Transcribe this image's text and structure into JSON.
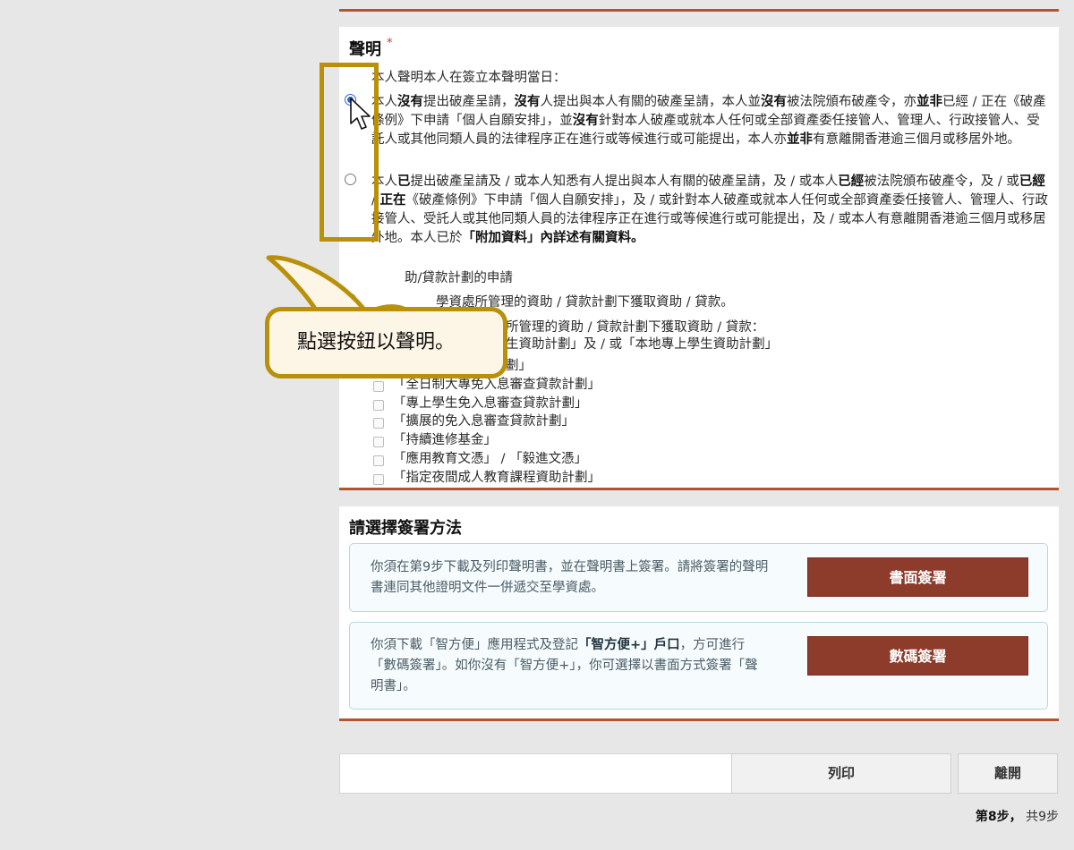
{
  "declaration": {
    "title": "聲明",
    "required_mark": "*",
    "intro": "本人聲明本人在簽立本聲明當日：",
    "option1": {
      "selected": true,
      "text_html": "本人<b>沒有</b>提出破產呈請，<b>沒有</b>人提出與本人有關的破產呈請，本人並<b>沒有</b>被法院頒布破產令，亦<b>並非</b>已經 / 正在《破產條例》下申請「個人自願安排」，並<b>沒有</b>針對本人破產或就本人任何或全部資產委任接管人、管理人、行政接管人、受託人或其他同類人員的法律程序正在進行或等候進行或可能提出，本人亦<b>並非</b>有意離開香港逾三個月或移居外地。"
    },
    "option2": {
      "selected": false,
      "text_html": "本人<b>已</b>提出破產呈請及 / 或本人知悉有人提出與本人有關的破產呈請，及 / 或本人<b>已經</b>被法院頒布破產令，及 / 或<b>已經</b> / <b>正在</b>《破產條例》下申請「個人自願安排」，及 / 或針對本人破產或就本人任何或全部資產委任接管人、管理人、行政接管人、受託人或其他同類人員的法律程序正在進行或等候進行或可能提出，及 / 或本人有意離開香港逾三個月或移居外地。本人已於<b>「附加資料」內詳述有關資料。</b>"
    }
  },
  "aid": {
    "heading": "助/貸款計劃的申請",
    "option1": {
      "selected": true,
      "text": "學資處所管理的資助 / 貸款計劃下獲取資助 / 貸款。"
    },
    "option2_line1": "所管理的資助 / 貸款計劃下獲取資助 / 貸款：",
    "option2_line2": "生資助計劃」及 / 或「本地專上學生資助計劃」",
    "checkboxes": [
      "劃」",
      "「全日制大專免入息審查貸款計劃」",
      "「專上學生免入息審查貸款計劃」",
      "「擴展的免入息審查貸款計劃」",
      "「持續進修基金」",
      "「應用教育文憑」 / 「毅進文憑」",
      "「指定夜間成人教育課程資助計劃」"
    ]
  },
  "sign": {
    "title": "請選擇簽署方法",
    "paper": {
      "text_html": "你須在第9步下載及列印聲明書，並在聲明書上簽署。請將簽署的聲明書連同其他證明文件一併遞交至學資處。",
      "button": "書面簽署"
    },
    "digital": {
      "text_html": "你須下載「智方便」應用程式及登記<b>「智方便+」戶口</b>，方可進行「數碼簽署」。如你沒有「智方便+」，你可選擇以書面方式簽署「聲明書」。",
      "button": "數碼簽署"
    }
  },
  "footer": {
    "print_button": "列印",
    "exit_button": "離開",
    "step_current": "第8步，",
    "step_total": "共9步"
  },
  "callout": {
    "text": "點選按鈕以聲明。"
  },
  "colors": {
    "accent_rule": "#b5532c",
    "sign_button": "#8d3b2a",
    "highlight": "#b8900a",
    "radio_selected": "#2b63d9"
  }
}
